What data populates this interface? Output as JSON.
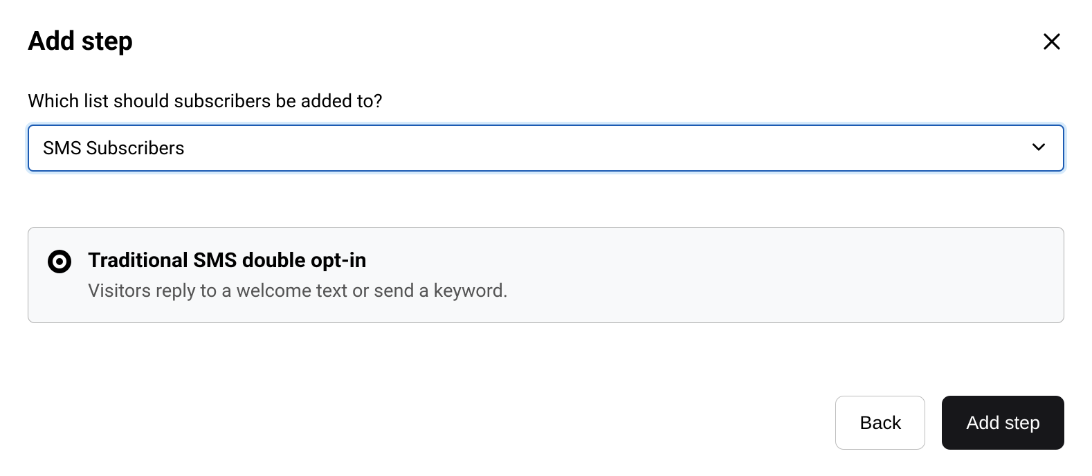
{
  "header": {
    "title": "Add step"
  },
  "form": {
    "listLabel": "Which list should subscribers be added to?",
    "selectedList": "SMS Subscribers"
  },
  "options": [
    {
      "title": "Traditional SMS double opt-in",
      "description": "Visitors reply to a welcome text or send a keyword.",
      "selected": true
    }
  ],
  "footer": {
    "backLabel": "Back",
    "addStepLabel": "Add step"
  }
}
